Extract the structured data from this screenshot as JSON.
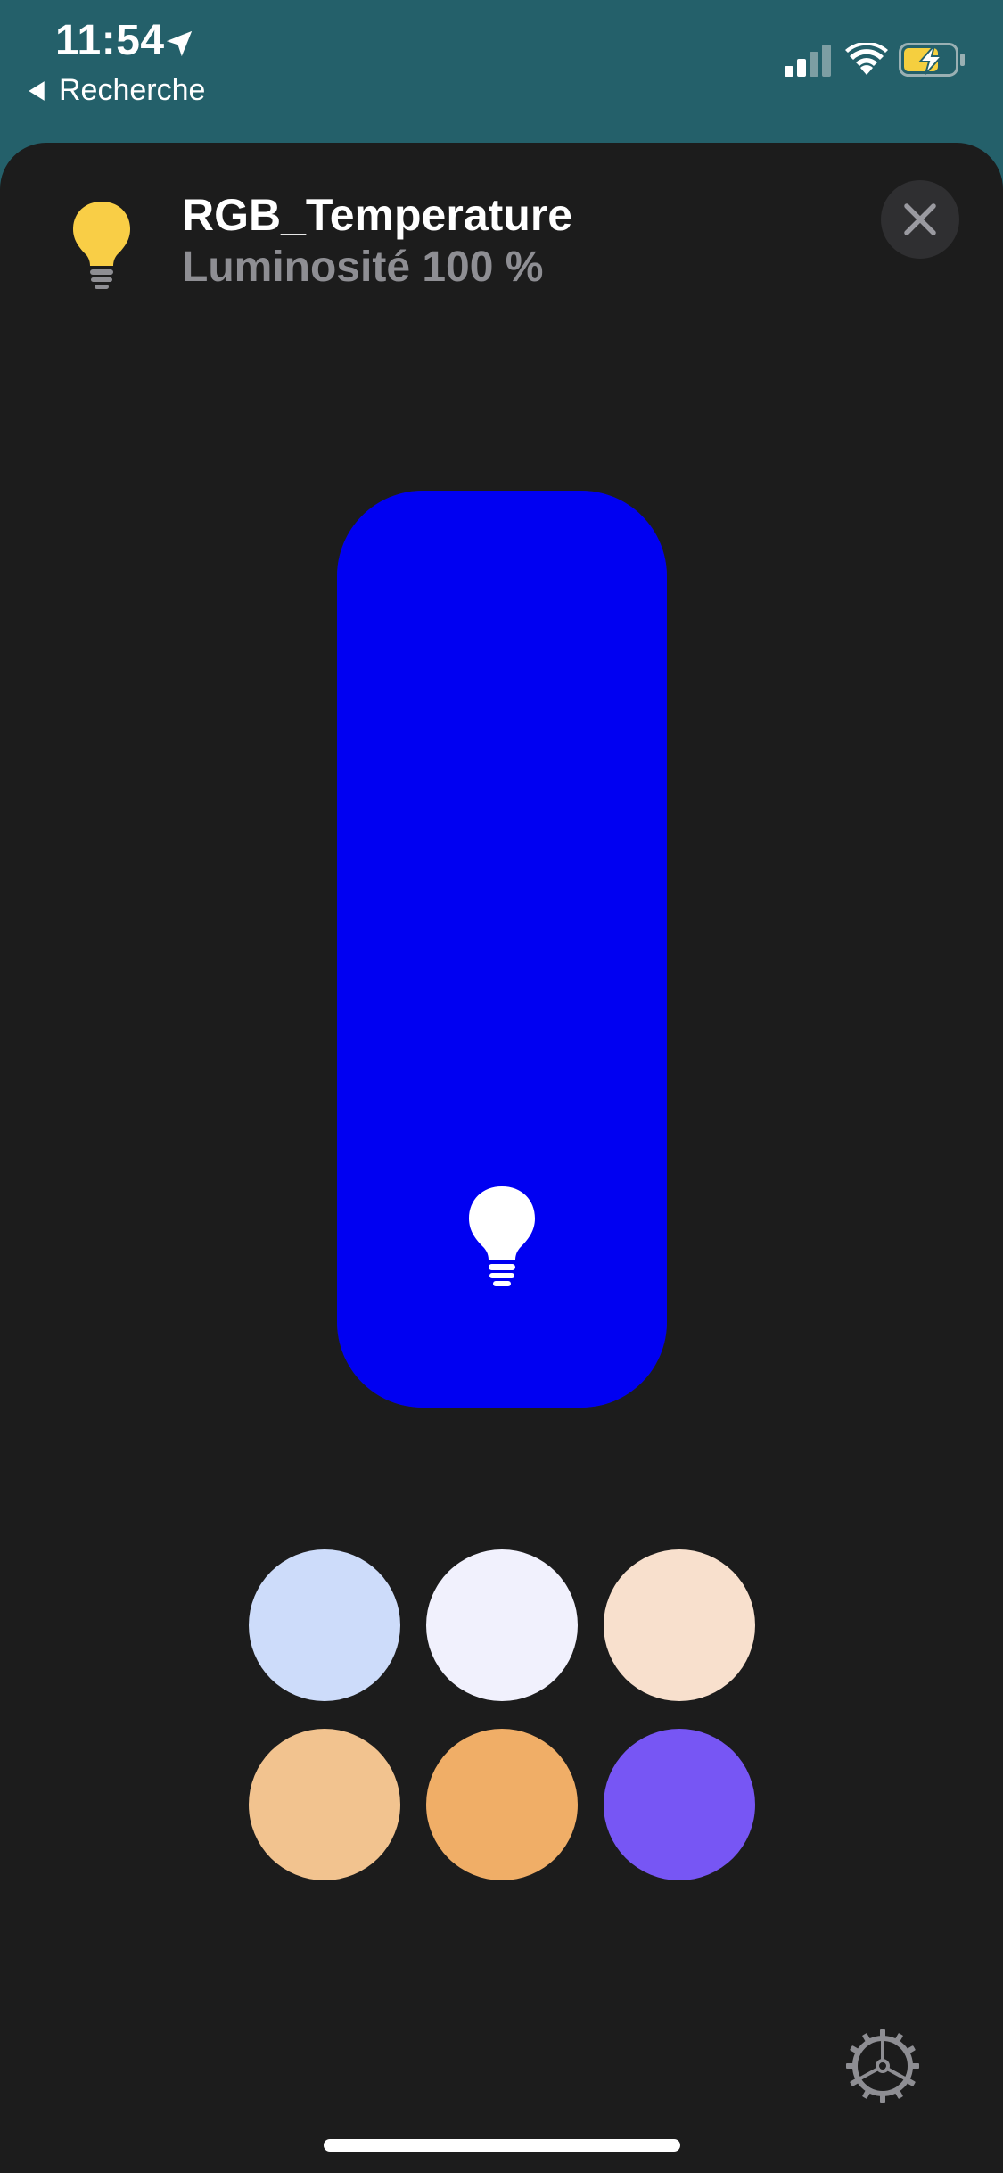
{
  "status_bar": {
    "time": "11:54",
    "back_label": "Recherche",
    "icons": [
      "location-arrow-icon",
      "cellular-signal-icon",
      "wifi-icon",
      "battery-charging-icon"
    ]
  },
  "accessory": {
    "name": "RGB_Temperature",
    "status": "Luminosité 100 %",
    "icon": "lightbulb-icon",
    "icon_color": "#f9ce46"
  },
  "brightness": {
    "level_percent": 100,
    "fill_color": "#0000f2"
  },
  "presets": [
    {
      "color": "#cddcfa"
    },
    {
      "color": "#f1f1fd"
    },
    {
      "color": "#f8e0cd"
    },
    {
      "color": "#f2c38f"
    },
    {
      "color": "#f0ae67"
    },
    {
      "color": "#7756f4"
    }
  ],
  "controls": {
    "close_icon": "close-icon",
    "settings_icon": "gear-icon"
  }
}
